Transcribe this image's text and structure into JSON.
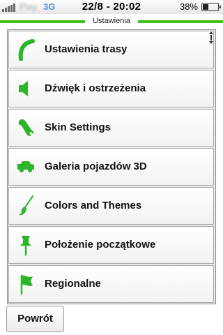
{
  "status_bar": {
    "carrier": "Play",
    "network": "3G",
    "time": "22/8 - 20:02",
    "battery_percent": "38%",
    "battery_level": 0.38
  },
  "header": {
    "title": "Ustawienia"
  },
  "menu": {
    "items": [
      {
        "label": "Ustawienia trasy",
        "icon": "route-curve-icon"
      },
      {
        "label": "Dźwięk i ostrzeżenia",
        "icon": "speaker-icon"
      },
      {
        "label": "Skin Settings",
        "icon": "wrench-icon"
      },
      {
        "label": "Galeria pojazdów 3D",
        "icon": "car-icon"
      },
      {
        "label": "Colors and Themes",
        "icon": "paintbrush-icon"
      },
      {
        "label": "Położenie początkowe",
        "icon": "pushpin-icon"
      },
      {
        "label": "Regionalne",
        "icon": "flag-icon"
      }
    ]
  },
  "footer": {
    "back_label": "Powrót"
  },
  "colors": {
    "accent": "#3cc121",
    "icon_green": "#2db52a"
  }
}
